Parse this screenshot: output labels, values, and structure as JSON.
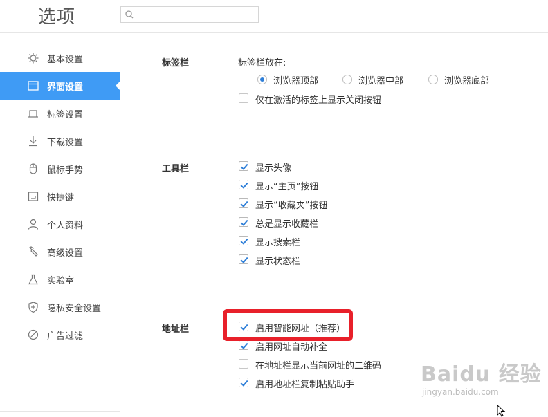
{
  "header": {
    "title": "选项",
    "search_placeholder": ""
  },
  "sidebar": {
    "items": [
      {
        "label": "基本设置",
        "icon": "gear-icon"
      },
      {
        "label": "界面设置",
        "icon": "window-icon",
        "active": true
      },
      {
        "label": "标签设置",
        "icon": "tab-icon"
      },
      {
        "label": "下载设置",
        "icon": "download-icon"
      },
      {
        "label": "鼠标手势",
        "icon": "mouse-icon"
      },
      {
        "label": "快捷键",
        "icon": "keyboard-icon"
      },
      {
        "label": "个人资料",
        "icon": "user-icon"
      },
      {
        "label": "高级设置",
        "icon": "wrench-icon"
      },
      {
        "label": "实验室",
        "icon": "flask-icon"
      },
      {
        "label": "隐私安全设置",
        "icon": "shield-icon"
      },
      {
        "label": "广告过滤",
        "icon": "block-icon"
      }
    ]
  },
  "tabbar": {
    "title": "标签栏",
    "position_label": "标签栏放在:",
    "options": [
      {
        "label": "浏览器顶部",
        "selected": true
      },
      {
        "label": "浏览器中部",
        "selected": false
      },
      {
        "label": "浏览器底部",
        "selected": false
      }
    ],
    "close_button_option": {
      "label": "仅在激活的标签上显示关闭按钮",
      "checked": false
    }
  },
  "toolbar": {
    "title": "工具栏",
    "options": [
      {
        "label": "显示头像",
        "checked": true
      },
      {
        "label": "显示“主页”按钮",
        "checked": true
      },
      {
        "label": "显示“收藏夹”按钮",
        "checked": true
      },
      {
        "label": "总是显示收藏栏",
        "checked": true
      },
      {
        "label": "显示搜索栏",
        "checked": true
      },
      {
        "label": "显示状态栏",
        "checked": true
      }
    ]
  },
  "addressbar": {
    "title": "地址栏",
    "options": [
      {
        "label": "启用智能网址（推荐）",
        "checked": true
      },
      {
        "label": "启用网址自动补全",
        "checked": true
      },
      {
        "label": "在地址栏显示当前网址的二维码",
        "checked": false
      },
      {
        "label": "启用地址栏复制粘贴助手",
        "checked": true
      }
    ]
  },
  "watermark": {
    "logo": "Baidu 经验",
    "url": "jingyan.baidu.com"
  },
  "colors": {
    "accent": "#3f9bf5",
    "highlight": "#e8202a",
    "check": "#2f7fd8"
  }
}
